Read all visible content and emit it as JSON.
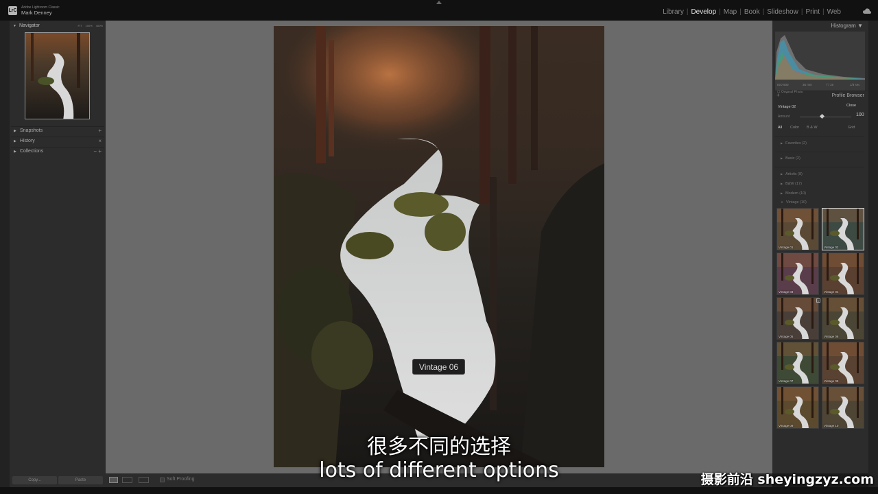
{
  "app": {
    "logo_text": "LrC",
    "name": "Adobe Lightroom Classic",
    "user": "Mark Denney"
  },
  "modules": [
    {
      "label": "Library",
      "active": false
    },
    {
      "label": "Develop",
      "active": true
    },
    {
      "label": "Map",
      "active": false
    },
    {
      "label": "Book",
      "active": false
    },
    {
      "label": "Slideshow",
      "active": false
    },
    {
      "label": "Print",
      "active": false
    },
    {
      "label": "Web",
      "active": false
    }
  ],
  "left_panel": {
    "navigator": {
      "label": "Navigator",
      "zoom_options": [
        "FIT",
        "100%",
        "400%"
      ]
    },
    "sections": [
      {
        "label": "Snapshots",
        "control": "+"
      },
      {
        "label": "History",
        "control": "×"
      },
      {
        "label": "Collections",
        "control": "− +"
      }
    ],
    "copy_label": "Copy...",
    "paste_label": "Paste"
  },
  "toolbar": {
    "soft_proofing_label": "Soft Proofing"
  },
  "tooltip": {
    "text": "Vintage 06"
  },
  "right_panel": {
    "histogram_label": "Histogram",
    "histogram_meta": [
      "ISO 500",
      "35 mm",
      "f / 16",
      "1/3 sec"
    ],
    "original_photo_label": "Original Photo",
    "profile_browser_label": "Profile Browser",
    "profile_name": "Vintage 02",
    "close_label": "Close",
    "amount_label": "Amount",
    "amount_value": "100",
    "filters": [
      {
        "label": "All",
        "active": true
      },
      {
        "label": "Color",
        "active": false
      },
      {
        "label": "B & W",
        "active": false
      }
    ],
    "view_label": "Grid",
    "groups": [
      {
        "label": "Favorites (2)",
        "expanded": false
      },
      {
        "label": "Basic (2)",
        "expanded": false
      },
      {
        "label": "Artistic (8)",
        "expanded": false
      },
      {
        "label": "B&W (17)",
        "expanded": false
      },
      {
        "label": "Modern (10)",
        "expanded": false
      },
      {
        "label": "Vintage (10)",
        "expanded": true
      }
    ],
    "thumbnails": [
      {
        "label": "Vintage 01",
        "tint": "#5a4a35"
      },
      {
        "label": "Vintage 02",
        "tint": "#3d4a44"
      },
      {
        "label": "Vintage 03",
        "tint": "#5a3d4a"
      },
      {
        "label": "Vintage 04",
        "tint": "#5a4030"
      },
      {
        "label": "Vintage 05",
        "tint": "#4a3f38"
      },
      {
        "label": "Vintage 06",
        "tint": "#4a4535"
      },
      {
        "label": "Vintage 07",
        "tint": "#3e4a35"
      },
      {
        "label": "Vintage 08",
        "tint": "#5a4232"
      },
      {
        "label": "Vintage 09",
        "tint": "#5c4a2e"
      },
      {
        "label": "Vintage 10",
        "tint": "#4e4535"
      }
    ],
    "selected_index": 1,
    "hovered_index": 5
  },
  "subtitles": {
    "chinese": "很多不同的选择",
    "english": "lots of different options"
  },
  "watermark": "摄影前沿 sheyingzyz.com"
}
